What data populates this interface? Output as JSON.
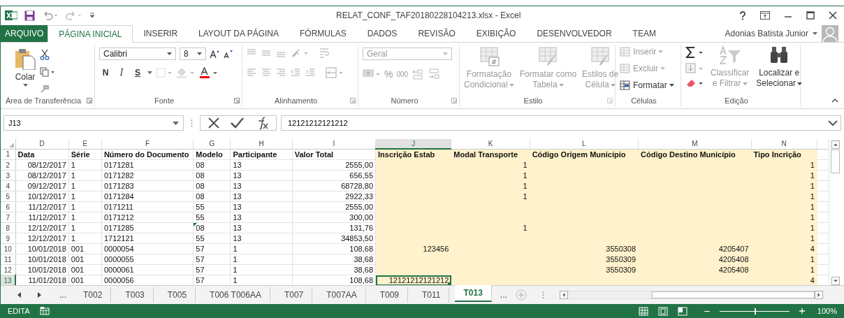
{
  "window": {
    "title": "RELAT_CONF_TAF20180228104213.xlsx - Excel"
  },
  "ribbon_tabs": [
    {
      "label": "ARQUIVO",
      "kind": "file",
      "selected": false
    },
    {
      "label": "PÁGINA INICIAL",
      "kind": "tab",
      "selected": true
    },
    {
      "label": "INSERIR",
      "kind": "tab",
      "selected": false
    },
    {
      "label": "LAYOUT DA PÁGINA",
      "kind": "tab",
      "selected": false
    },
    {
      "label": "FÓRMULAS",
      "kind": "tab",
      "selected": false
    },
    {
      "label": "DADOS",
      "kind": "tab",
      "selected": false
    },
    {
      "label": "REVISÃO",
      "kind": "tab",
      "selected": false
    },
    {
      "label": "EXIBIÇÃO",
      "kind": "tab",
      "selected": false
    },
    {
      "label": "DESENVOLVEDOR",
      "kind": "tab",
      "selected": false
    },
    {
      "label": "TEAM",
      "kind": "tab",
      "selected": false
    }
  ],
  "user": {
    "name": "Adonias Batista Junior"
  },
  "ribbon": {
    "clipboard": {
      "label": "Área de Transferência",
      "paste": "Colar"
    },
    "font": {
      "label": "Fonte",
      "family": "Calibri",
      "size": "8",
      "bold": "N",
      "italic": "I",
      "underline": "S"
    },
    "alignment": {
      "label": "Alinhamento"
    },
    "number": {
      "label": "Número",
      "format": "Geral",
      "percent": "%",
      "thousands": "000"
    },
    "styles": {
      "label": "Estilo",
      "buttons": [
        {
          "lines": [
            "Formatação",
            "Condicional"
          ],
          "disabled": true
        },
        {
          "lines": [
            "Formatar como",
            "Tabela"
          ],
          "disabled": true
        },
        {
          "lines": [
            "Estilos de",
            "Célula"
          ],
          "disabled": true
        }
      ]
    },
    "cells": {
      "label": "Células",
      "buttons": [
        {
          "label": "Inserir",
          "disabled": true
        },
        {
          "label": "Excluir",
          "disabled": true
        },
        {
          "label": "Formatar",
          "disabled": false
        }
      ]
    },
    "editing": {
      "label": "Edição",
      "buttons": [
        {
          "lines": [
            "Classificar",
            "e Filtrar"
          ],
          "disabled": true
        },
        {
          "lines": [
            "Localizar e",
            "Selecionar"
          ],
          "disabled": false
        }
      ]
    }
  },
  "formula_bar": {
    "name_box": "J13",
    "value": "12121212121212"
  },
  "columns": [
    {
      "letter": "D",
      "header": "Data",
      "selected": false,
      "highlighted": false
    },
    {
      "letter": "E",
      "header": "Série",
      "selected": false,
      "highlighted": false
    },
    {
      "letter": "F",
      "header": "Número do Documento",
      "selected": false,
      "highlighted": false
    },
    {
      "letter": "G",
      "header": "Modelo",
      "selected": false,
      "highlighted": false
    },
    {
      "letter": "H",
      "header": "Participante",
      "selected": false,
      "highlighted": false
    },
    {
      "letter": "I",
      "header": "Valor Total",
      "selected": false,
      "highlighted": false
    },
    {
      "letter": "J",
      "header": "Inscrição Estab",
      "selected": true,
      "highlighted": true
    },
    {
      "letter": "K",
      "header": "Modal Transporte",
      "selected": false,
      "highlighted": true
    },
    {
      "letter": "L",
      "header": "Código Origem Município",
      "selected": false,
      "highlighted": true
    },
    {
      "letter": "M",
      "header": "Código Destino Município",
      "selected": false,
      "highlighted": true
    },
    {
      "letter": "N",
      "header": "Tipo Incrição",
      "selected": false,
      "highlighted": true
    }
  ],
  "rows": [
    {
      "number": "2",
      "selected": false,
      "cells": [
        "08/12/2017",
        "1",
        "0171281",
        "08",
        "13",
        "2555,00",
        "",
        "1",
        "",
        "",
        "1"
      ]
    },
    {
      "number": "3",
      "selected": false,
      "cells": [
        "08/12/2017",
        "1",
        "0171282",
        "08",
        "13",
        "656,55",
        "",
        "1",
        "",
        "",
        "1"
      ]
    },
    {
      "number": "4",
      "selected": false,
      "cells": [
        "09/12/2017",
        "1",
        "0171283",
        "08",
        "13",
        "68728,80",
        "",
        "1",
        "",
        "",
        "1"
      ]
    },
    {
      "number": "5",
      "selected": false,
      "cells": [
        "10/12/2017",
        "1",
        "0171284",
        "08",
        "13",
        "2922,33",
        "",
        "1",
        "",
        "",
        "1"
      ]
    },
    {
      "number": "6",
      "selected": false,
      "cells": [
        "11/12/2017",
        "1",
        "0171211",
        "55",
        "13",
        "2555,00",
        "",
        "",
        "",
        "",
        "1"
      ]
    },
    {
      "number": "7",
      "selected": false,
      "cells": [
        "11/12/2017",
        "1",
        "0171212",
        "55",
        "13",
        "300,00",
        "",
        "",
        "",
        "",
        "1"
      ]
    },
    {
      "number": "8",
      "selected": false,
      "cells": [
        "12/12/2017",
        "1",
        "0171285",
        {
          "text": "08",
          "error": true
        },
        "13",
        "131,76",
        "",
        "1",
        "",
        "",
        "1"
      ]
    },
    {
      "number": "9",
      "selected": false,
      "cells": [
        "12/12/2017",
        "1",
        "1712121",
        "55",
        "13",
        "34853,50",
        "",
        "",
        "",
        "",
        "1"
      ]
    },
    {
      "number": "10",
      "selected": false,
      "cells": [
        "10/01/2018",
        "001",
        "0000054",
        "57",
        "1",
        "108,68",
        "123456",
        "",
        "3550308",
        "4205407",
        "4"
      ]
    },
    {
      "number": "11",
      "selected": false,
      "cells": [
        "10/01/2018",
        "001",
        "0000055",
        "57",
        "1",
        "38,68",
        "",
        "",
        "3550309",
        "4205408",
        "1"
      ]
    },
    {
      "number": "12",
      "selected": false,
      "cells": [
        "10/01/2018",
        "001",
        "0000061",
        "57",
        "1",
        "38,68",
        "",
        "",
        "3550309",
        "4205408",
        "1"
      ]
    },
    {
      "number": "13",
      "selected": true,
      "cells": [
        "11/01/2018",
        "001",
        "0000056",
        "57",
        "1",
        "108,68",
        "12121212121212",
        "",
        "",
        "",
        "4"
      ]
    }
  ],
  "header_row_number": "1",
  "sheet_nav": {
    "more_left": "...",
    "more_right": "..."
  },
  "sheet_tabs": [
    {
      "label": "T002",
      "selected": false
    },
    {
      "label": "T003",
      "selected": false
    },
    {
      "label": "T005",
      "selected": false
    },
    {
      "label": "T006 T006AA",
      "selected": false
    },
    {
      "label": "T007",
      "selected": false
    },
    {
      "label": "T007AA",
      "selected": false
    },
    {
      "label": "T009",
      "selected": false
    },
    {
      "label": "T011",
      "selected": false
    },
    {
      "label": "T013",
      "selected": true
    }
  ],
  "status_bar": {
    "mode": "EDITA",
    "zoom": "100%",
    "zoom_slider": {
      "level": 0.5
    }
  }
}
